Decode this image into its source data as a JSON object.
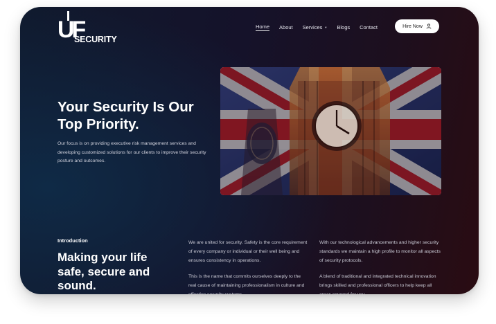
{
  "brand": {
    "logo_mark": "UF",
    "logo_text": "SECURITY"
  },
  "nav": {
    "items": [
      {
        "label": "Home",
        "active": true
      },
      {
        "label": "About"
      },
      {
        "label": "Services",
        "has_dropdown": true
      },
      {
        "label": "Blogs"
      },
      {
        "label": "Contact"
      }
    ],
    "cta_label": "Hire Now",
    "cta_icon": "user-icon"
  },
  "hero": {
    "title": "Your Security Is Our Top Priority.",
    "body": "Our focus is on providing executive risk management services and developing customized solutions for our clients to improve their security posture and outcomes.",
    "image_subject": "Big Ben with Union Jack flag overlay"
  },
  "intro": {
    "label": "Introduction",
    "title": "Making your life safe, secure and sound.",
    "col1": [
      "We are united for security. Safety is the core requirement of every company or individual or their well being and ensures consistency in operations.",
      "This is the name that commits ourselves deeply to the real cause of maintaining professionalism in culture and effective security systems."
    ],
    "col2": [
      "With our technological advancements and higher security standards we maintain a high profile to monitor all aspects of security protocols.",
      "A blend of traditional and integrated technical innovation brings skilled and professional officers to help keep all areas covered for you."
    ]
  },
  "colors": {
    "bg_dark": "#15122a",
    "text_white": "#ffffff",
    "muted_text": "#c9c9d4"
  }
}
